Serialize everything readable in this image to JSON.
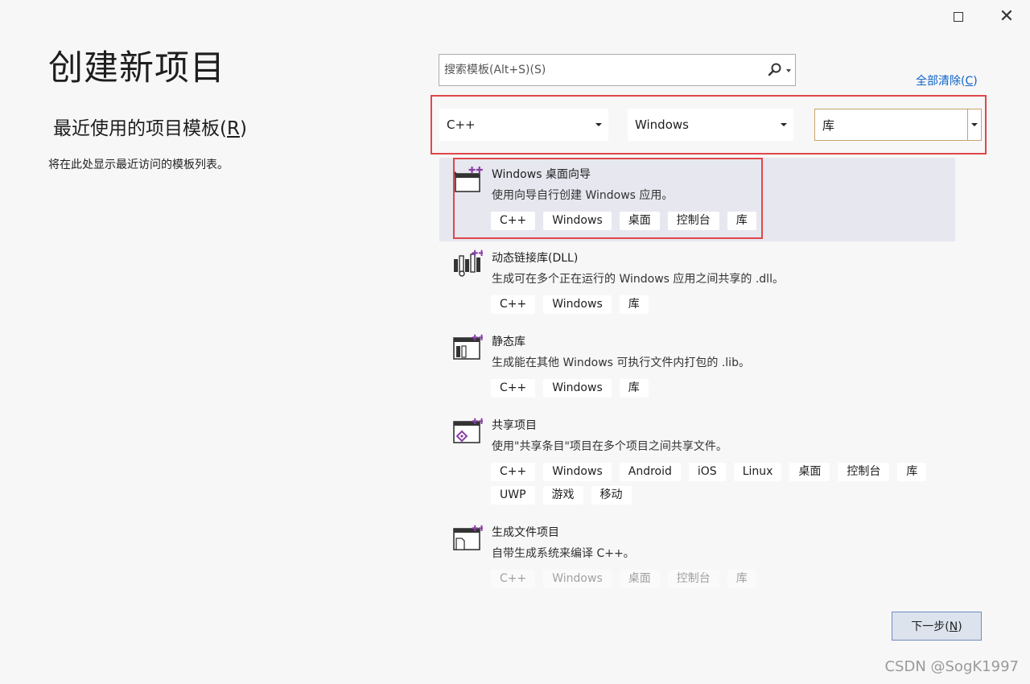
{
  "window": {
    "maximize_icon": "maximize-icon",
    "close_icon": "close-icon",
    "close_glyph": "✕"
  },
  "title": "创建新项目",
  "recent": {
    "heading": "最近使用的项目模板(R)",
    "empty_text": "将在此处显示最近访问的模板列表。"
  },
  "search": {
    "placeholder": "搜索模板(Alt+S)(S)",
    "icon": "search-icon"
  },
  "clear_all": "全部清除(C)",
  "filters": {
    "language": "C++",
    "platform": "Windows",
    "project_type": "库"
  },
  "templates": [
    {
      "name": "Windows 桌面向导",
      "desc": "使用向导自行创建 Windows 应用。",
      "icon": "windows-desktop-wizard-icon",
      "tags": [
        "C++",
        "Windows",
        "桌面",
        "控制台",
        "库"
      ],
      "selected": true
    },
    {
      "name": "动态链接库(DLL)",
      "desc": "生成可在多个正在运行的 Windows 应用之间共享的 .dll。",
      "icon": "dll-icon",
      "tags": [
        "C++",
        "Windows",
        "库"
      ]
    },
    {
      "name": "静态库",
      "desc": "生成能在其他 Windows 可执行文件内打包的 .lib。",
      "icon": "static-library-icon",
      "tags": [
        "C++",
        "Windows",
        "库"
      ]
    },
    {
      "name": "共享项目",
      "desc": "使用\"共享条目\"项目在多个项目之间共享文件。",
      "icon": "shared-project-icon",
      "tags": [
        "C++",
        "Windows",
        "Android",
        "iOS",
        "Linux",
        "桌面",
        "控制台",
        "库",
        "UWP",
        "游戏",
        "移动"
      ]
    },
    {
      "name": "生成文件项目",
      "desc": "自带生成系统来编译 C++。",
      "icon": "makefile-project-icon",
      "tags": [
        "C++",
        "Windows",
        "桌面",
        "控制台",
        "库"
      ]
    }
  ],
  "next_button": "下一步(N)",
  "watermark": "CSDN @SogK1997",
  "colors": {
    "highlight": "#e0464a",
    "link": "#0e62c6",
    "selected_bg": "#e6e7ef",
    "icon_accent": "#8a3ea8"
  }
}
